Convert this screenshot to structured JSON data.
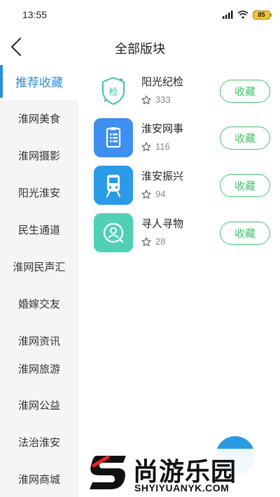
{
  "status_bar": {
    "time": "13:55",
    "battery": "85"
  },
  "header": {
    "title": "全部版块"
  },
  "sidebar": {
    "items": [
      {
        "label": "推荐收藏",
        "active": true
      },
      {
        "label": "淮网美食"
      },
      {
        "label": "淮网摄影"
      },
      {
        "label": "阳光淮安"
      },
      {
        "label": "民生通道"
      },
      {
        "label": "淮网民声汇"
      },
      {
        "label": "婚嫁交友"
      },
      {
        "label": "淮网资讯"
      },
      {
        "label": "淮网旅游"
      },
      {
        "label": "淮网公益"
      },
      {
        "label": "法治淮安"
      },
      {
        "label": "淮网商城"
      }
    ]
  },
  "boards": [
    {
      "name": "阳光纪检",
      "count": "333",
      "action": "收藏",
      "icon": "shield-check-icon",
      "icon_text": "检",
      "color": "#ffffff"
    },
    {
      "name": "淮安网事",
      "count": "116",
      "action": "收藏",
      "icon": "clipboard-list-icon",
      "color": "#3f8ff0"
    },
    {
      "name": "淮安振兴",
      "count": "94",
      "action": "收藏",
      "icon": "train-icon",
      "color": "#2b9be8"
    },
    {
      "name": "寻人寻物",
      "count": "28",
      "action": "收藏",
      "icon": "person-search-icon",
      "color": "#4fd0b7"
    }
  ],
  "watermark": {
    "title": "尚游乐园",
    "subtitle": "SHYIYUANYK.COM"
  },
  "colors": {
    "accent": "#2a8fd7",
    "favorite": "#43c26a",
    "sidebar_bg": "#f5f5f5"
  }
}
